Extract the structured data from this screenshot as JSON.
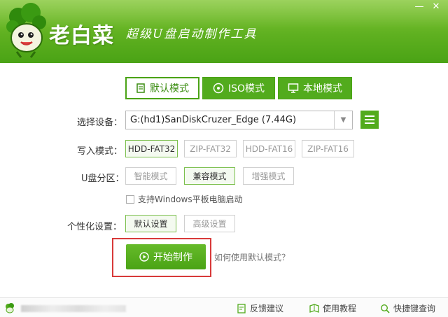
{
  "header": {
    "title": "老白菜",
    "slogan": "超级U盘启动制作工具",
    "controls": {
      "minimize": "—",
      "close": "✕"
    },
    "colors": {
      "brand_green": "#52ab1d",
      "highlight_red": "#d83a3a"
    }
  },
  "tabs": [
    {
      "label": "默认模式",
      "icon": "doc-icon",
      "active": true
    },
    {
      "label": "ISO模式",
      "icon": "disc-icon",
      "active": false
    },
    {
      "label": "本地模式",
      "icon": "monitor-icon",
      "active": false
    }
  ],
  "device": {
    "label": "选择设备：",
    "value": "G:(hd1)SanDiskCruzer_Edge (7.44G)",
    "arrow": "▼"
  },
  "write_mode": {
    "label": "写入模式：",
    "options": [
      "HDD-FAT32",
      "ZIP-FAT32",
      "HDD-FAT16",
      "ZIP-FAT16"
    ],
    "selected": "HDD-FAT32"
  },
  "partition": {
    "label": "U盘分区：",
    "options": [
      "智能模式",
      "兼容模式",
      "增强模式"
    ],
    "selected": "兼容模式"
  },
  "tablet": {
    "label": "支持Windows平板电脑启动",
    "checked": false
  },
  "personalize": {
    "label": "个性化设置：",
    "options": [
      "默认设置",
      "高级设置"
    ],
    "selected": "默认设置"
  },
  "start": {
    "label": "开始制作",
    "help": "如何使用默认模式？"
  },
  "footer": {
    "links": [
      {
        "label": "反馈建议",
        "icon": "feedback-icon"
      },
      {
        "label": "使用教程",
        "icon": "tutorial-icon"
      },
      {
        "label": "快捷键查询",
        "icon": "search-icon"
      }
    ]
  }
}
